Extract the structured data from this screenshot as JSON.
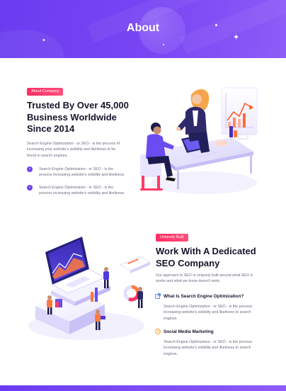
{
  "hero": {
    "title": "About"
  },
  "section1": {
    "badge": "About Company",
    "title_lines": [
      "Trusted By Over 45,000",
      "Business Worldwide",
      "Since 2014"
    ],
    "description_lines": [
      "Search Engine Optimization - or SEO - is the process of",
      "increasing your website's visibility and likeliness to be",
      "found in search engines."
    ],
    "list": [
      {
        "lines": [
          "Search Engine Optimization - or SEO - is the",
          "process increasing website's visibility and likeliness"
        ]
      },
      {
        "lines": [
          "Search Engine Optimization - or SEO - is the",
          "process increasing website's visibility and likeliness"
        ]
      }
    ]
  },
  "section2": {
    "badge": "Uniquely Built",
    "title_lines": [
      "Work With A Dedicated",
      "SEO Company"
    ],
    "description_lines": [
      "Our approach to SEO is uniquely built around what SEO is",
      "works and what we know doesn't work."
    ],
    "features": [
      {
        "title": "What Is Search Engine Optimization?",
        "lines": [
          "Search Engine Optimization - or SEO - is the process",
          "increasing website's visibility and likeliness to search",
          "engines."
        ]
      },
      {
        "title": "Social Media Marketing",
        "lines": [
          "Search Engine Optimization - or SEO - is the process",
          "increasing website's visibility and likeliness to search",
          "engines."
        ]
      }
    ]
  },
  "colors": {
    "primary": "#6a3cf0",
    "accent": "#ff2e63",
    "orange": "#ff8a00"
  },
  "icons": {
    "bullet": "chevron-right-icon",
    "feature1": "open-external-icon",
    "feature2": "clock-icon"
  }
}
